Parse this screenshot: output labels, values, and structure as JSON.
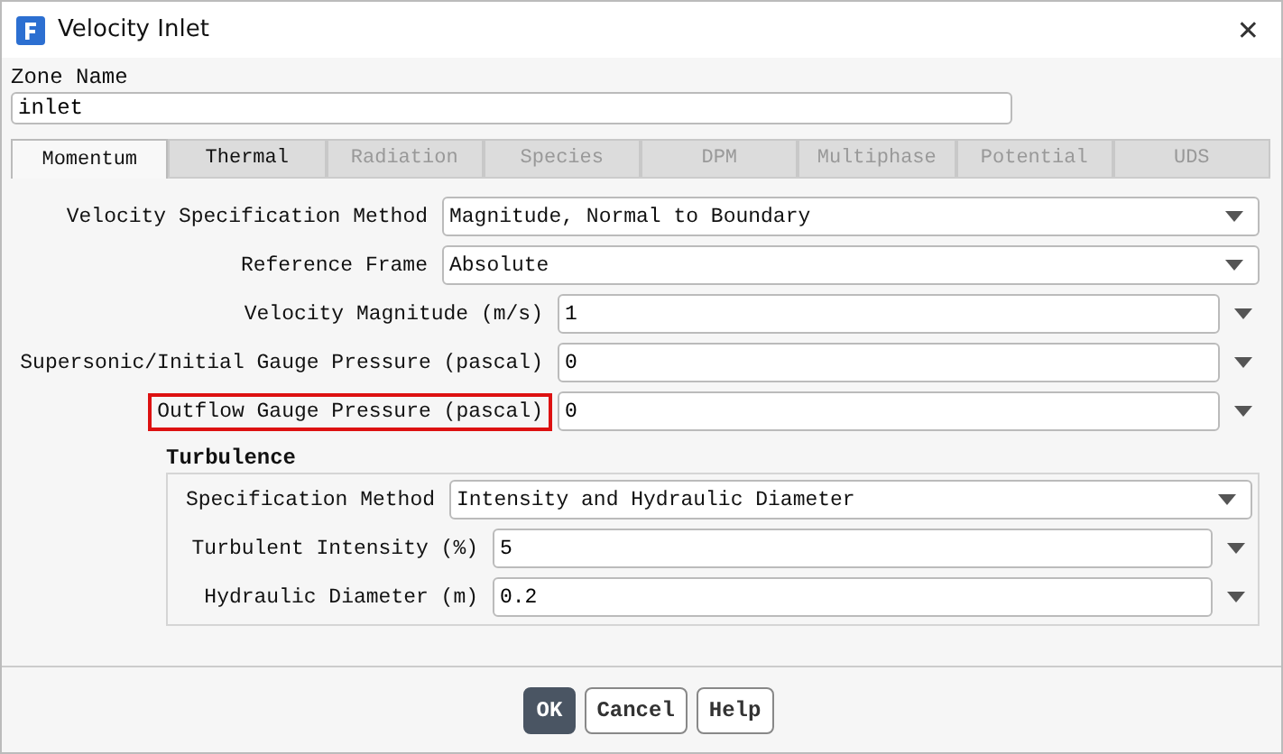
{
  "window": {
    "title": "Velocity Inlet",
    "close": "✕"
  },
  "zone_name": {
    "label": "Zone Name",
    "value": "inlet"
  },
  "tabs": [
    {
      "label": "Momentum",
      "selected": true,
      "disabled": false
    },
    {
      "label": "Thermal",
      "selected": false,
      "disabled": false
    },
    {
      "label": "Radiation",
      "selected": false,
      "disabled": true
    },
    {
      "label": "Species",
      "selected": false,
      "disabled": true
    },
    {
      "label": "DPM",
      "selected": false,
      "disabled": true
    },
    {
      "label": "Multiphase",
      "selected": false,
      "disabled": true
    },
    {
      "label": "Potential",
      "selected": false,
      "disabled": true
    },
    {
      "label": "UDS",
      "selected": false,
      "disabled": true
    }
  ],
  "fields": [
    {
      "kind": "dropdown",
      "label": "Velocity Specification Method",
      "value": "Magnitude, Normal to Boundary",
      "highlighted": false
    },
    {
      "kind": "dropdown",
      "label": "Reference Frame",
      "value": "Absolute",
      "highlighted": false
    },
    {
      "kind": "number",
      "label": "Velocity Magnitude (m/s)",
      "value": "1",
      "highlighted": false
    },
    {
      "kind": "number",
      "label": "Supersonic/Initial Gauge Pressure (pascal)",
      "value": "0",
      "highlighted": false
    },
    {
      "kind": "number",
      "label": "Outflow Gauge Pressure (pascal)",
      "value": "0",
      "highlighted": true
    }
  ],
  "turbulence": {
    "title": "Turbulence",
    "fields": [
      {
        "kind": "dropdown",
        "label": "Specification Method",
        "value": "Intensity and Hydraulic Diameter",
        "highlighted": false
      },
      {
        "kind": "number",
        "label": "Turbulent Intensity (%)",
        "value": "5",
        "highlighted": false
      },
      {
        "kind": "number",
        "label": "Hydraulic Diameter (m)",
        "value": "0.2",
        "highlighted": false
      }
    ]
  },
  "buttons": [
    {
      "label": "OK",
      "primary": true
    },
    {
      "label": "Cancel",
      "primary": false
    },
    {
      "label": "Help",
      "primary": false
    }
  ]
}
